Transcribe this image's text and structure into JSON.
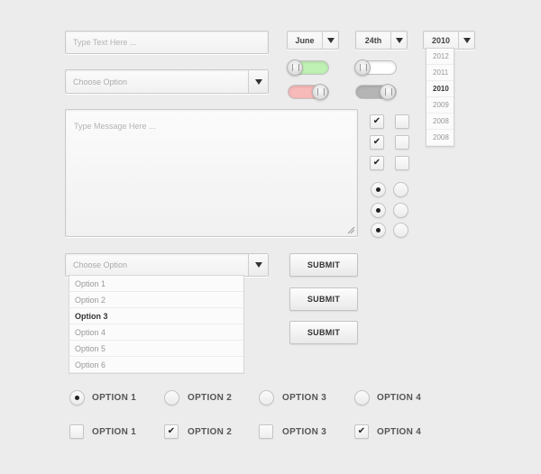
{
  "text_input": {
    "placeholder": "Type Text Here ..."
  },
  "select1": {
    "placeholder": "Choose Option"
  },
  "textarea": {
    "placeholder": "Type Message Here ..."
  },
  "month_select": {
    "value": "June"
  },
  "day_select": {
    "value": "24th"
  },
  "year_select": {
    "value": "2010",
    "options": [
      "2012",
      "2011",
      "2010",
      "2009",
      "2008",
      "2008"
    ],
    "selected_index": 2
  },
  "toggles": [
    {
      "state": "on",
      "color": "#bff0b4"
    },
    {
      "state": "off",
      "color": "#ffffff"
    },
    {
      "state": "on",
      "color": "#f8b9b9"
    },
    {
      "state": "off",
      "color": "#b5b5b5"
    }
  ],
  "checkbox_grid": [
    [
      true,
      false
    ],
    [
      true,
      false
    ],
    [
      true,
      false
    ]
  ],
  "radio_grid": [
    [
      true,
      false
    ],
    [
      true,
      false
    ],
    [
      true,
      false
    ]
  ],
  "select2": {
    "placeholder": "Choose Option",
    "options": [
      "Option 1",
      "Option 2",
      "Option 3",
      "Option 4",
      "Option 5",
      "Option 6"
    ],
    "selected_index": 2
  },
  "buttons": [
    "SUBMIT",
    "SUBMIT",
    "SUBMIT"
  ],
  "radio_row": {
    "labels": [
      "OPTION 1",
      "OPTION 2",
      "OPTION 3",
      "OPTION 4"
    ],
    "checked": [
      true,
      false,
      false,
      false
    ]
  },
  "checkbox_row": {
    "labels": [
      "OPTION 1",
      "OPTION 2",
      "OPTION 3",
      "OPTION 4"
    ],
    "checked": [
      false,
      true,
      false,
      true
    ]
  }
}
